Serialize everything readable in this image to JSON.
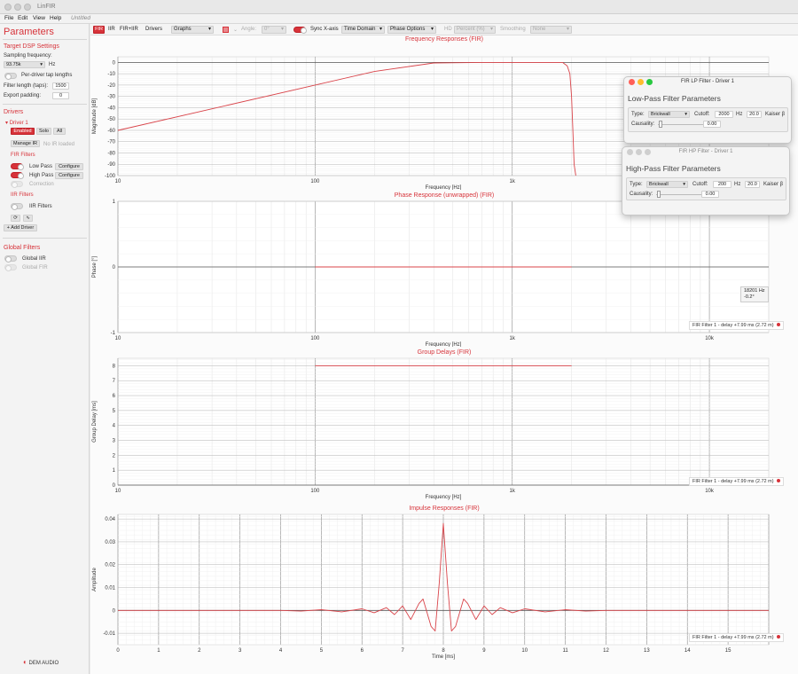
{
  "app": {
    "name": "LinFIR",
    "colors": {
      "accent": "#d7333a",
      "curve": "#d9444a"
    }
  },
  "menu": {
    "file": "File",
    "edit": "Edit",
    "view": "View",
    "help": "Help",
    "doc": "Untitled"
  },
  "sidebar": {
    "title": "Parameters",
    "target": {
      "heading": "Target DSP Settings",
      "fs_label": "Sampling frequency:",
      "fs_value": "93.75k",
      "fs_unit": "Hz",
      "per_driver": "Per-driver tap lengths",
      "filter_len_label": "Filter length (taps):",
      "filter_len_value": "1500",
      "export_label": "Export padding:",
      "export_value": "0"
    },
    "drivers": {
      "heading": "Drivers",
      "driver1": "Driver 1",
      "enabled": "Enabled",
      "solo": "Solo",
      "all": "All",
      "manage_ir": "Manage IR",
      "no_ir": "No IR loaded",
      "fir_heading": "FIR Filters",
      "low_pass": "Low Pass",
      "high_pass": "High Pass",
      "configure": "Configure",
      "correction": "Correction",
      "iir_heading": "IIR Filters",
      "iir_filters": "IIR Filters",
      "add_driver": "+ Add Driver"
    },
    "global": {
      "heading": "Global Filters",
      "iir": "Global IIR",
      "fir": "Global FIR"
    },
    "logo": "DEM AUDIO"
  },
  "toolbar": {
    "fir": "FIR",
    "iir": "IIR",
    "firiir": "FIR+IIR",
    "drivers": "Drivers",
    "graphs": "Graphs",
    "angle_label": "Angle:",
    "angle_value": "0°",
    "sync": "Sync X-axis",
    "time_domain": "Time Domain",
    "phase_options": "Phase Options",
    "hd": "HD",
    "percent": "Percent (%)",
    "smoothing": "Smoothing",
    "smoothing_value": "None"
  },
  "plots": {
    "freq": {
      "title": "Frequency Responses (FIR)",
      "xlabel": "Frequency [Hz]",
      "ylabel": "Magnitude [dB]"
    },
    "phase": {
      "title": "Phase Response (unwrapped) (FIR)",
      "xlabel": "Frequency [Hz]",
      "ylabel": "Phase [°]",
      "legend": "FIR Filter 1 - delay +7.99 ms (2.72 m)",
      "tip_line1": "18201 Hz",
      "tip_line2": "-0.2°"
    },
    "group": {
      "title": "Group Delays (FIR)",
      "xlabel": "Frequency [Hz]",
      "ylabel": "Group Delay [ms]",
      "legend": "FIR Filter 1 - delay +7.99 ms (2.72 m)"
    },
    "impulse": {
      "title": "Impulse Responses (FIR)",
      "xlabel": "Time [ms]",
      "ylabel": "Amplitude",
      "legend": "FIR Filter 1 - delay +7.99 ms (2.72 m)"
    }
  },
  "lp_window": {
    "title": "FIR LP Filter - Driver 1",
    "heading": "Low-Pass Filter Parameters",
    "type_label": "Type:",
    "type_value": "Brickwall",
    "cutoff_label": "Cutoff:",
    "cutoff_value": "2000",
    "hz": "Hz",
    "slope_value": "20.0",
    "kaiser": "Kaiser β",
    "causality": "Causality:",
    "causality_value": "0.00"
  },
  "hp_window": {
    "title": "FIR HP Filter - Driver 1",
    "heading": "High-Pass Filter Parameters",
    "type_label": "Type:",
    "type_value": "Brickwall",
    "cutoff_label": "Cutoff:",
    "cutoff_value": "200",
    "hz": "Hz",
    "slope_value": "20.0",
    "kaiser": "Kaiser β",
    "causality": "Causality:",
    "causality_value": "0.00"
  },
  "chart_data": [
    {
      "type": "line",
      "title": "Frequency Responses (FIR)",
      "xlabel": "Frequency [Hz]",
      "ylabel": "Magnitude [dB]",
      "xscale": "log",
      "xlim": [
        10,
        20000
      ],
      "ylim": [
        -100,
        5
      ],
      "xticks": [
        "10",
        "100",
        "1k",
        "10k"
      ],
      "yticks": [
        0,
        -10,
        -20,
        -30,
        -40,
        -50,
        -60,
        -70,
        -80,
        -90,
        -100
      ],
      "series": [
        {
          "x": [
            10,
            30,
            100,
            200,
            400,
            700,
            1000,
            1500,
            1800,
            1900,
            1960,
            2000,
            2030,
            2060,
            2100
          ],
          "y": [
            -60,
            -41,
            -20,
            -8,
            -0.5,
            0,
            0,
            0,
            0,
            -3,
            -10,
            -30,
            -60,
            -90,
            -100
          ]
        }
      ]
    },
    {
      "type": "line",
      "title": "Phase Response (unwrapped) (FIR)",
      "xlabel": "Frequency [Hz]",
      "ylabel": "Phase [°]",
      "xscale": "log",
      "xlim": [
        10,
        20000
      ],
      "ylim": [
        -1,
        1
      ],
      "xticks": [
        "10",
        "100",
        "1k",
        "10k"
      ],
      "yticks": [
        1,
        0,
        -1
      ],
      "series": [
        {
          "x": [
            100,
            2000
          ],
          "y": [
            0,
            0
          ]
        }
      ]
    },
    {
      "type": "line",
      "title": "Group Delays (FIR)",
      "xlabel": "Frequency [Hz]",
      "ylabel": "Group Delay [ms]",
      "xscale": "log",
      "xlim": [
        10,
        20000
      ],
      "ylim": [
        0,
        8.5
      ],
      "xticks": [
        "10",
        "100",
        "1k",
        "10k"
      ],
      "yticks": [
        8,
        7,
        6,
        5,
        4,
        3,
        2,
        1,
        0
      ],
      "series": [
        {
          "x": [
            100,
            2000
          ],
          "y": [
            8,
            8
          ]
        }
      ]
    },
    {
      "type": "line",
      "title": "Impulse Responses (FIR)",
      "xlabel": "Time [ms]",
      "ylabel": "Amplitude",
      "xlim": [
        0,
        16
      ],
      "ylim": [
        -0.015,
        0.042
      ],
      "xticks": [
        "0",
        "1",
        "2",
        "3",
        "4",
        "5",
        "6",
        "7",
        "8",
        "9",
        "10",
        "11",
        "12",
        "13",
        "14",
        "15"
      ],
      "yticks": [
        0.04,
        0.03,
        0.02,
        0.01,
        0,
        -0.01
      ],
      "series": [
        {
          "x": [
            0,
            4,
            4.5,
            5,
            5.5,
            6,
            6.3,
            6.6,
            6.8,
            7,
            7.2,
            7.4,
            7.5,
            7.7,
            7.8,
            7.9,
            8,
            8.1,
            8.2,
            8.3,
            8.5,
            8.6,
            8.8,
            9,
            9.2,
            9.4,
            9.7,
            10,
            10.5,
            11,
            11.5,
            12,
            16
          ],
          "y": [
            0,
            0,
            -0.0003,
            0.0003,
            -0.0006,
            0.0007,
            -0.001,
            0.0012,
            -0.0018,
            0.002,
            -0.004,
            0.003,
            0.005,
            -0.007,
            -0.009,
            0.012,
            0.038,
            0.012,
            -0.009,
            -0.007,
            0.005,
            0.003,
            -0.004,
            0.002,
            -0.0018,
            0.0012,
            -0.001,
            0.0007,
            -0.0006,
            0.0003,
            -0.0003,
            0,
            0
          ]
        }
      ]
    }
  ]
}
